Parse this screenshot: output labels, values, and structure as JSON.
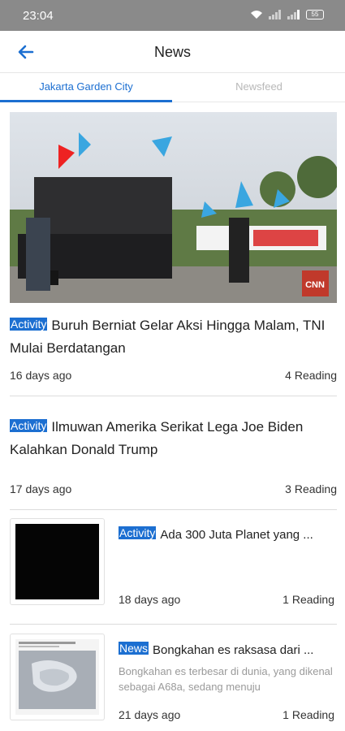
{
  "status_bar": {
    "time": "23:04",
    "battery": "55"
  },
  "app_bar": {
    "title": "News"
  },
  "tabs": [
    {
      "label": "Jakarta Garden City",
      "active": true
    },
    {
      "label": "Newsfeed",
      "active": false
    }
  ],
  "articles": [
    {
      "badge": "Activity",
      "title": "Buruh Berniat Gelar Aksi Hingga Malam, TNI Mulai Berdatangan",
      "age": "16 days ago",
      "reading": "4 Reading",
      "image_watermark": "CNN"
    },
    {
      "badge": "Activity",
      "title": "Ilmuwan Amerika Serikat Lega Joe Biden Kalahkan Donald Trump",
      "age": "17 days ago",
      "reading": "3 Reading"
    },
    {
      "badge": "Activity",
      "title": "Ada 300 Juta Planet yang ...",
      "age": "18 days ago",
      "reading": "1 Reading"
    },
    {
      "badge": "News",
      "title": "Bongkahan es raksasa dari ...",
      "excerpt": "Bongkahan es terbesar di dunia, yang dikenal sebagai A68a, sedang menuju",
      "age": "21 days ago",
      "reading": "1 Reading"
    }
  ],
  "colors": {
    "accent": "#1c6fd1",
    "status_bar": "#8a8a8a",
    "divider": "#dcdcdc"
  }
}
